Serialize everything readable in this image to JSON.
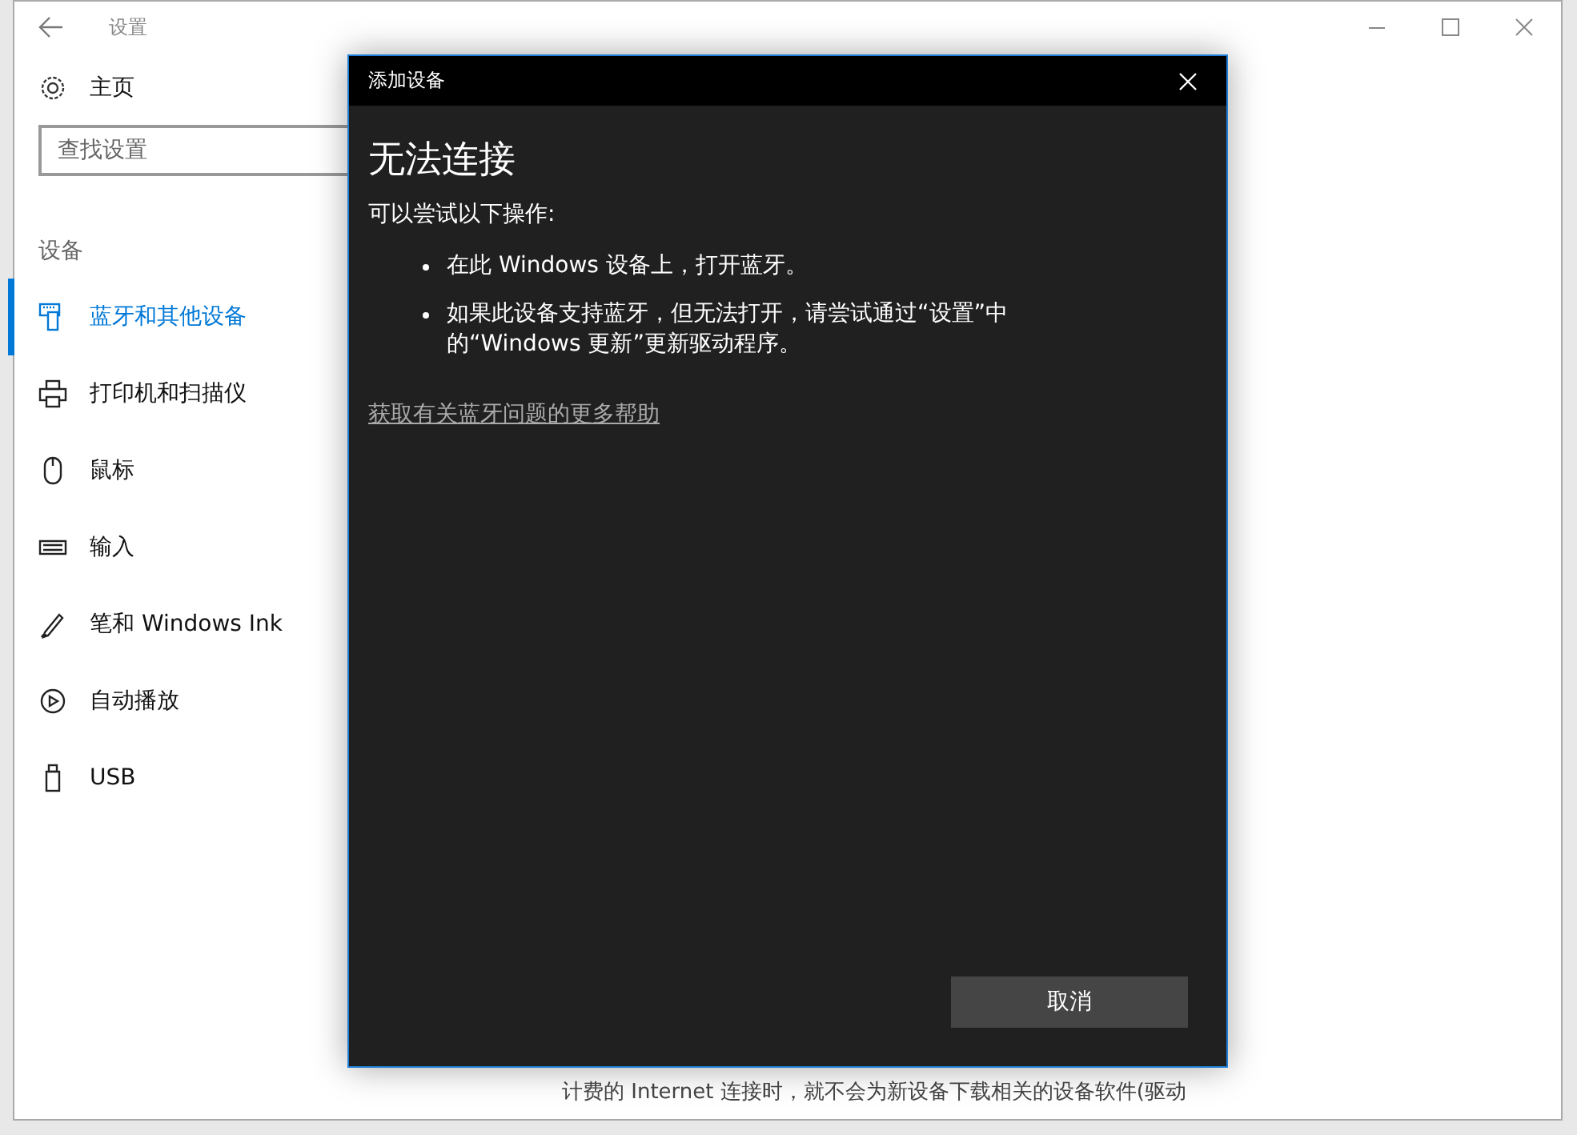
{
  "window": {
    "title": "设置"
  },
  "sidebar": {
    "home": "主页",
    "search": {
      "placeholder": "查找设置"
    },
    "section": "设备",
    "items": [
      {
        "label": "蓝牙和其他设备",
        "selected": true
      },
      {
        "label": "打印机和扫描仪",
        "selected": false
      },
      {
        "label": "鼠标",
        "selected": false
      },
      {
        "label": "输入",
        "selected": false
      },
      {
        "label": "笔和 Windows Ink",
        "selected": false
      },
      {
        "label": "自动播放",
        "selected": false
      },
      {
        "label": "USB",
        "selected": false
      }
    ]
  },
  "content": {
    "text": "计费的 Internet 连接时，就不会为新设备下载相关的设备软件(驱动"
  },
  "dialog": {
    "title": "添加设备",
    "heading": "无法连接",
    "intro": "可以尝试以下操作:",
    "bullets": [
      "在此 Windows 设备上，打开蓝牙。",
      "如果此设备支持蓝牙，但无法打开，请尝试通过“设置”中的“Windows 更新”更新驱动程序。"
    ],
    "link": "获取有关蓝牙问题的更多帮助",
    "button": "取消"
  }
}
